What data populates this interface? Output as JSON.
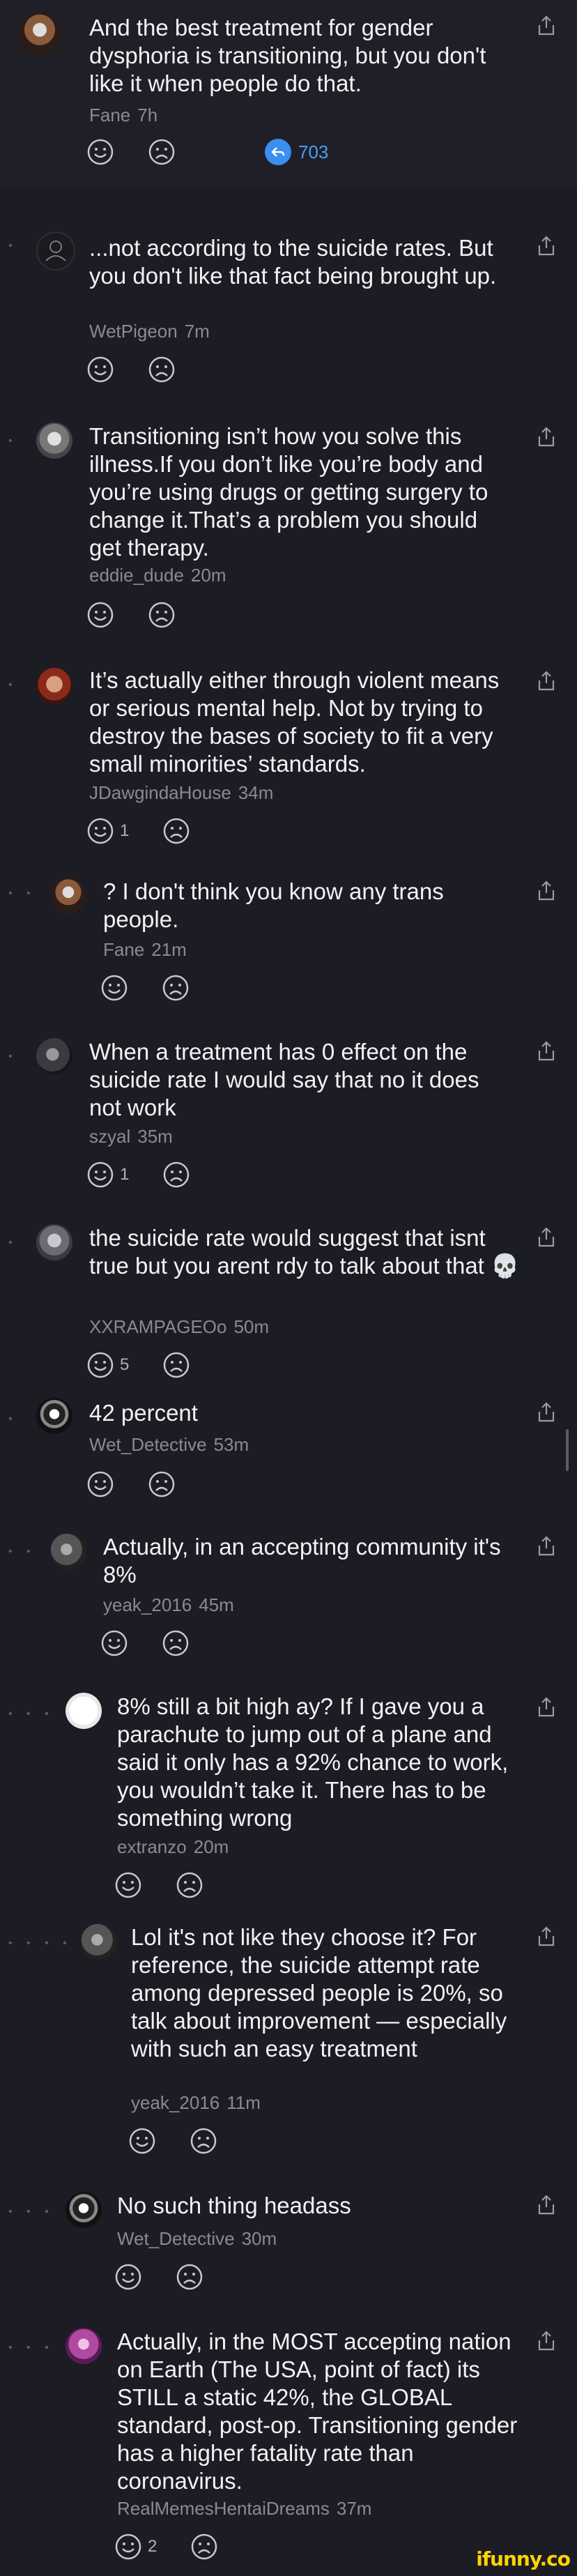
{
  "comments": [
    {
      "text": "And the best treatment for gender dysphoria is transitioning, but you don't like it when people do that.",
      "user": "Fane",
      "time": "7h",
      "upvotes": "",
      "reply_count": "703"
    },
    {
      "text": "...not according to the suicide rates. But you don't like that fact being brought up.",
      "user": "WetPigeon",
      "time": "7m",
      "upvotes": ""
    },
    {
      "text": "Transitioning isn’t how you solve this illness.If you don’t like you’re body and you’re using drugs or getting surgery to change it.That’s a problem you should get therapy.",
      "user": "eddie_dude",
      "time": "20m",
      "upvotes": ""
    },
    {
      "text": "It’s actually either through violent means or serious mental help. Not by trying to destroy the bases of society to fit a very small minorities’ standards.",
      "user": "JDawgindaHouse",
      "time": "34m",
      "upvotes": "1"
    },
    {
      "text": "? I don't think you know any trans people.",
      "user": "Fane",
      "time": "21m",
      "upvotes": ""
    },
    {
      "text": "When a treatment has 0 effect on the suicide rate I would say that no it does not work",
      "user": "szyal",
      "time": "35m",
      "upvotes": "1"
    },
    {
      "text": "the suicide rate would suggest that isnt true but you arent rdy to talk about that 💀",
      "user": "XXRAMPAGEOo",
      "time": "50m",
      "upvotes": "5"
    },
    {
      "text": "42 percent",
      "user": "Wet_Detective",
      "time": "53m",
      "upvotes": ""
    },
    {
      "text": "Actually, in an accepting community it's 8%",
      "user": "yeak_2016",
      "time": "45m",
      "upvotes": ""
    },
    {
      "text": "8% still a bit high ay? If I gave you a parachute to jump out of a plane and said it only has a 92% chance to work, you wouldn’t take it. There has to be something wrong",
      "user": "extranzo",
      "time": "20m",
      "upvotes": ""
    },
    {
      "text": "Lol it's not like they choose it? For reference, the suicide attempt rate among depressed people is 20%, so talk about improvement — especially with such an easy treatment",
      "user": "yeak_2016",
      "time": "11m",
      "upvotes": ""
    },
    {
      "text": "No such thing headass",
      "user": "Wet_Detective",
      "time": "30m",
      "upvotes": ""
    },
    {
      "text": "Actually, in the MOST accepting nation on Earth (The USA, point of fact) its STILL a static 42%, the GLOBAL standard, post-op. Transitioning gender has a higher fatality rate than coronavirus.",
      "user": "RealMemesHentaiDreams",
      "time": "37m",
      "upvotes": "2"
    }
  ],
  "watermark": "ifunny.co",
  "colors": {
    "background": "#1c1c24",
    "text": "#f2f2f5",
    "meta": "#8a8a96",
    "accent": "#3a8ff0",
    "watermark": "#ffd400"
  }
}
